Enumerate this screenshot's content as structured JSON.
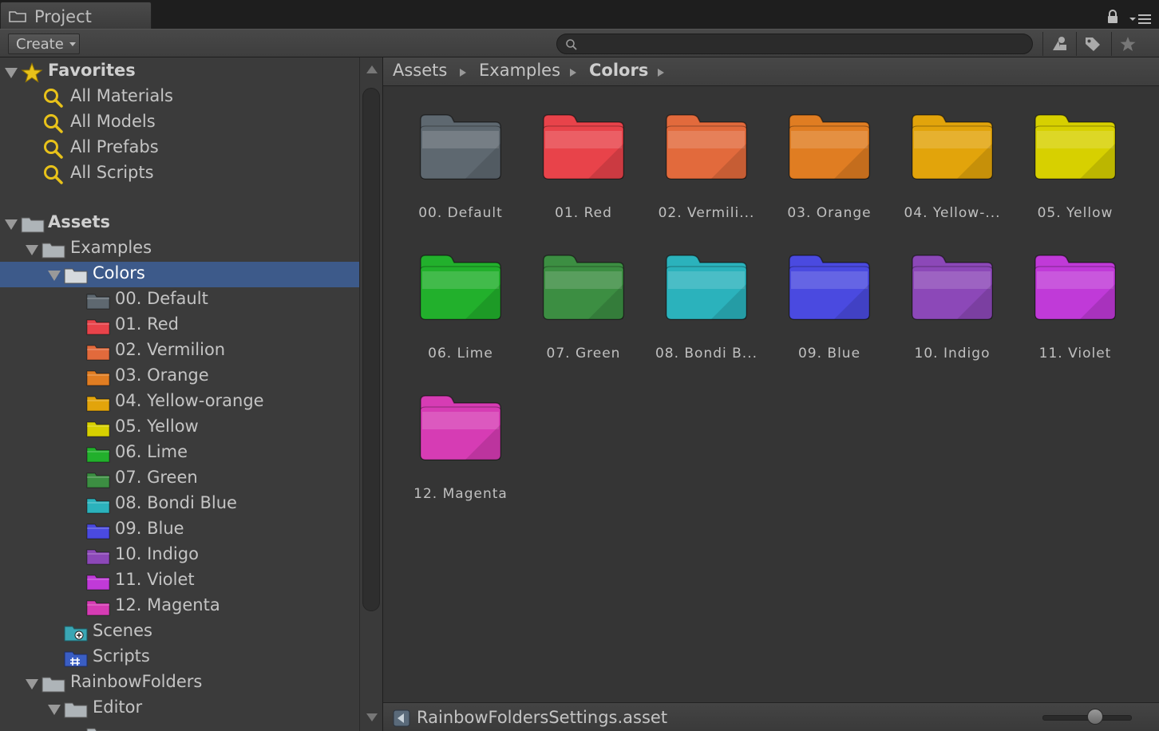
{
  "window": {
    "tab_label": "Project",
    "tab_icon": "folder-icon",
    "lock_icon": "lock-icon",
    "menu_icon": "panel-menu-icon"
  },
  "toolbar": {
    "create_label": "Create",
    "search_placeholder": "",
    "search_value": "",
    "buttons": [
      "filter-by-type-icon",
      "filter-by-label-icon",
      "favorite-star-icon"
    ]
  },
  "tree": {
    "favorites": {
      "label": "Favorites",
      "items": [
        "All Materials",
        "All Models",
        "All Prefabs",
        "All Scripts"
      ]
    },
    "assets_label": "Assets",
    "examples_label": "Examples",
    "colors_label": "Colors",
    "color_folders": [
      {
        "label": "00. Default",
        "color": "#5e6870"
      },
      {
        "label": "01. Red",
        "color": "#e8434a"
      },
      {
        "label": "02. Vermilion",
        "color": "#e26a3c"
      },
      {
        "label": "03. Orange",
        "color": "#e07d22"
      },
      {
        "label": "04. Yellow-orange",
        "color": "#e2a40b"
      },
      {
        "label": "05. Yellow",
        "color": "#d7d000"
      },
      {
        "label": "06. Lime",
        "color": "#22b02c"
      },
      {
        "label": "07. Green",
        "color": "#3c8e42"
      },
      {
        "label": "08. Bondi Blue",
        "color": "#2bb2bc"
      },
      {
        "label": "09. Blue",
        "color": "#4a4ae0"
      },
      {
        "label": "10. Indigo",
        "color": "#8c48b8"
      },
      {
        "label": "11. Violet",
        "color": "#c03ad8"
      },
      {
        "label": "12. Magenta",
        "color": "#d63cb4"
      }
    ],
    "scenes_label": "Scenes",
    "scripts_label": "Scripts",
    "rainbow_label": "RainbowFolders",
    "editor_label": "Editor"
  },
  "breadcrumb": [
    "Assets",
    "Examples",
    "Colors"
  ],
  "grid_tiles": [
    {
      "label": "00. Default",
      "color": "#5e6870"
    },
    {
      "label": "01. Red",
      "color": "#e8434a"
    },
    {
      "label": "02. Vermili...",
      "color": "#e26a3c"
    },
    {
      "label": "03. Orange",
      "color": "#e07d22"
    },
    {
      "label": "04. Yellow-...",
      "color": "#e2a40b"
    },
    {
      "label": "05. Yellow",
      "color": "#d7d000"
    },
    {
      "label": "06. Lime",
      "color": "#22b02c"
    },
    {
      "label": "07. Green",
      "color": "#3c8e42"
    },
    {
      "label": "08. Bondi B...",
      "color": "#2bb2bc"
    },
    {
      "label": "09. Blue",
      "color": "#4a4ae0"
    },
    {
      "label": "10. Indigo",
      "color": "#8c48b8"
    },
    {
      "label": "11. Violet",
      "color": "#c03ad8"
    },
    {
      "label": "12. Magenta",
      "color": "#d63cb4"
    }
  ],
  "status": {
    "file_label": "RainbowFoldersSettings.asset",
    "zoom_level": 0.6
  },
  "colors": {
    "selection": "#3d5a8a",
    "favorites_icon": "#e8c21a"
  }
}
